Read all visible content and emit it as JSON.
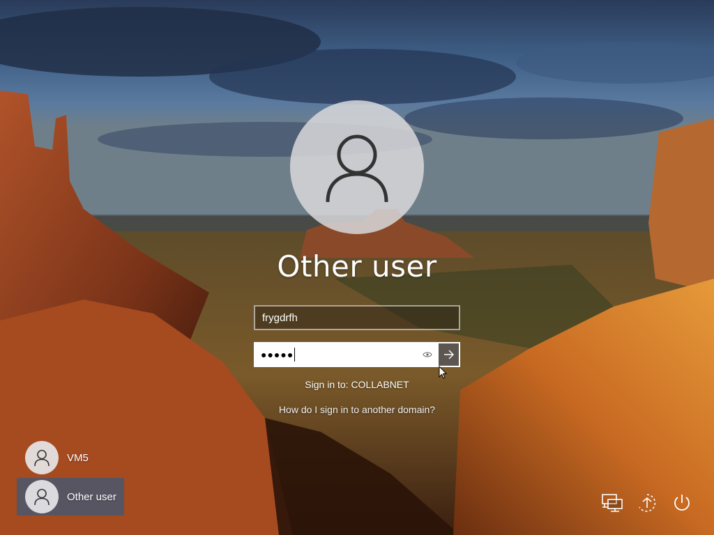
{
  "login": {
    "user_display_name": "Other user",
    "username_value": "frygdrfh",
    "password_masked": "●●●●●",
    "signin_to": "Sign in to: COLLABNET",
    "domain_help_link": "How do I sign in to another domain?"
  },
  "user_list": [
    {
      "label": "VM5",
      "selected": false
    },
    {
      "label": "Other user",
      "selected": true
    }
  ],
  "icons": {
    "avatar": "user-silhouette-icon",
    "reveal": "eye-icon",
    "submit": "arrow-right-icon",
    "network": "network-icon",
    "accessibility": "ease-of-access-icon",
    "power": "power-icon"
  },
  "colors": {
    "selected_tile": "#3c5a78",
    "submit_button": "#5d5550"
  }
}
